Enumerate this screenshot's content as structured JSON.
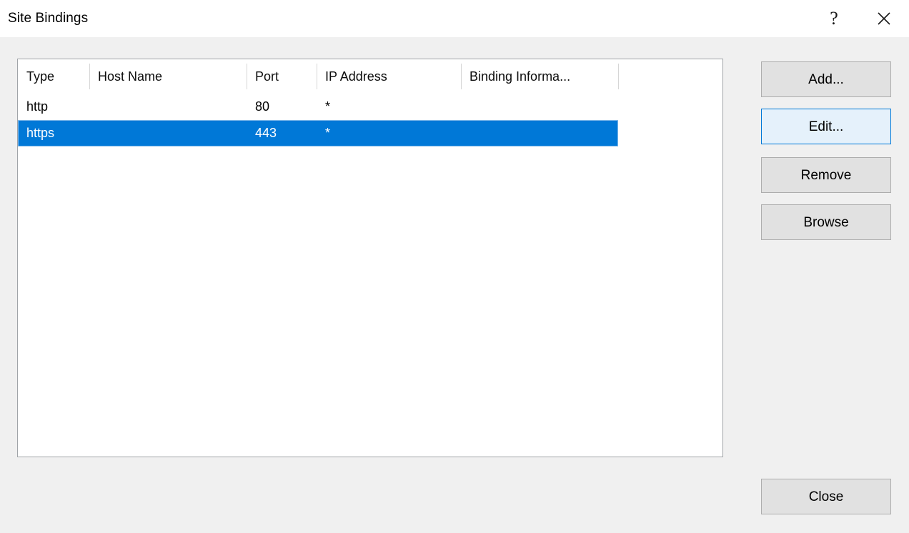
{
  "window": {
    "title": "Site Bindings",
    "help_glyph": "?",
    "close_glyph": "×",
    "background_color": "#f0f0f0",
    "titlebar_color": "#ffffff"
  },
  "list": {
    "columns": [
      {
        "key": "type",
        "label": "Type"
      },
      {
        "key": "host",
        "label": "Host Name"
      },
      {
        "key": "port",
        "label": "Port"
      },
      {
        "key": "ip",
        "label": "IP Address"
      },
      {
        "key": "binding",
        "label": "Binding Informa..."
      }
    ],
    "rows": [
      {
        "type": "http",
        "host": "",
        "port": "80",
        "ip": "*",
        "binding": "",
        "selected": false
      },
      {
        "type": "https",
        "host": "",
        "port": "443",
        "ip": "*",
        "binding": "",
        "selected": true
      }
    ],
    "selection_color": "#0078d7",
    "selection_text_color": "#ffffff",
    "border_color": "#a0a4a8"
  },
  "buttons": {
    "add": "Add...",
    "edit": "Edit...",
    "remove": "Remove",
    "browse": "Browse",
    "close": "Close",
    "focus_fill": "#e5f1fb",
    "focus_border": "#0078d7",
    "default_fill": "#e1e1e1",
    "default_border": "#adadad"
  }
}
